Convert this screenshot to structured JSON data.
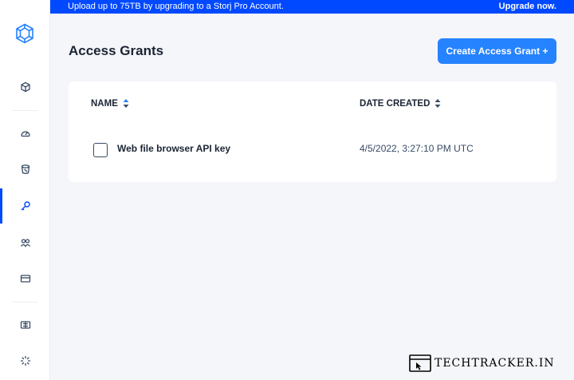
{
  "banner": {
    "message": "Upload up to 75TB by upgrading to a Storj Pro Account.",
    "upgrade_label": "Upgrade now."
  },
  "sidebar": {
    "logo_icon": "storj-logo-icon",
    "items": [
      {
        "icon": "cube-icon",
        "active": false
      },
      {
        "icon": "gauge-icon",
        "active": false
      },
      {
        "icon": "bucket-icon",
        "active": false
      },
      {
        "icon": "key-icon",
        "active": true
      },
      {
        "icon": "users-icon",
        "active": false
      },
      {
        "icon": "credit-card-icon",
        "active": false
      },
      {
        "icon": "resources-icon",
        "active": false
      },
      {
        "icon": "loading-icon",
        "active": false
      }
    ]
  },
  "page": {
    "title": "Access Grants",
    "create_button_label": "Create Access Grant +"
  },
  "table": {
    "columns": [
      "NAME",
      "DATE CREATED"
    ],
    "rows": [
      {
        "name": "Web file browser API key",
        "date_created": "4/5/2022, 3:27:10 PM UTC",
        "checked": false
      }
    ]
  },
  "watermark": {
    "text": "TECHTRACKER.IN"
  },
  "colors": {
    "accent": "#0149ff",
    "button": "#2683ff",
    "text_dark": "#1b2533",
    "background": "#f5f6fa"
  }
}
